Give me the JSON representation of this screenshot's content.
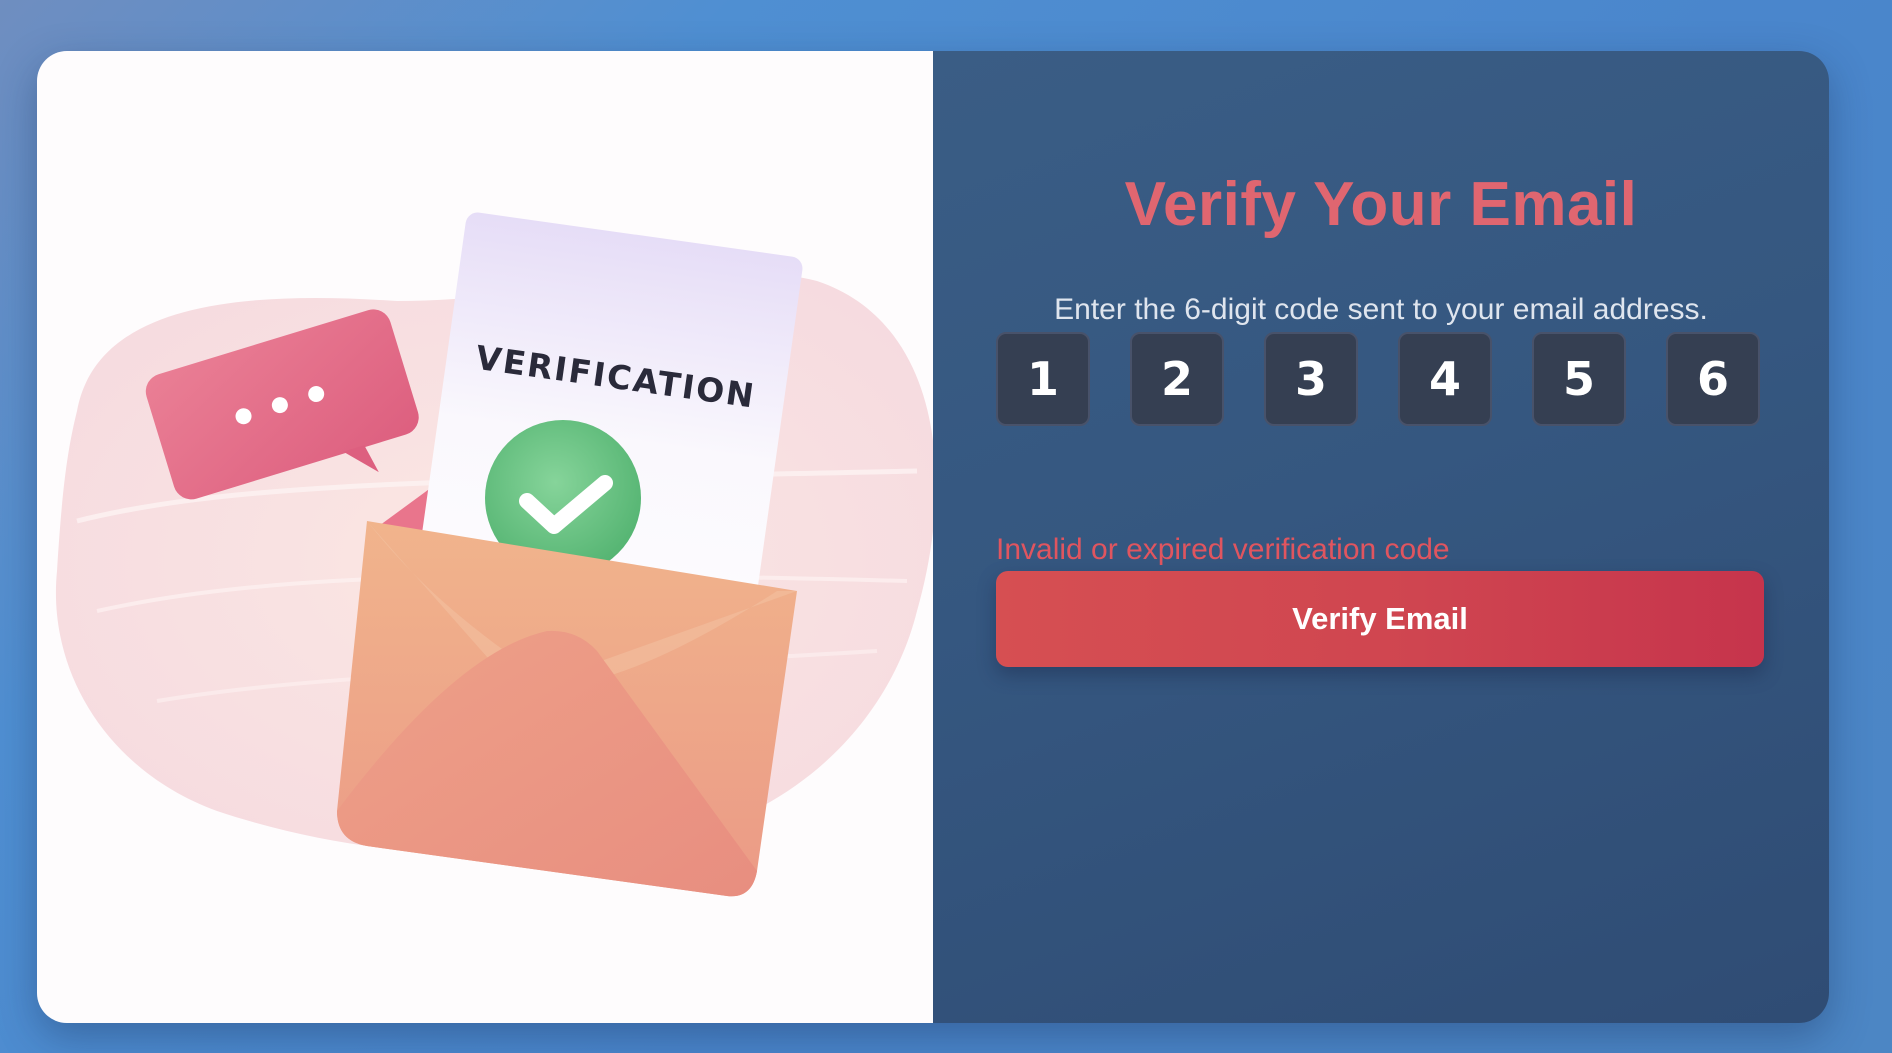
{
  "form": {
    "title": "Verify Your Email",
    "subtitle": "Enter the 6-digit code sent to your email address.",
    "code_digits": [
      "1",
      "2",
      "3",
      "4",
      "5",
      "6"
    ],
    "error_message": "Invalid or expired verification code",
    "submit_label": "Verify Email"
  },
  "illustration": {
    "document_label": "VERIFICATION",
    "chat_bubble_icon": "speech-bubble-ellipsis-icon",
    "status_icon": "check-circle-icon",
    "envelope_icon": "open-envelope-icon"
  },
  "colors": {
    "title": "#e06670",
    "error": "#e0555f",
    "button_start": "#d64f52",
    "button_end": "#c6344c",
    "panel_bg": "#355780",
    "code_box_bg": "#353f52"
  }
}
